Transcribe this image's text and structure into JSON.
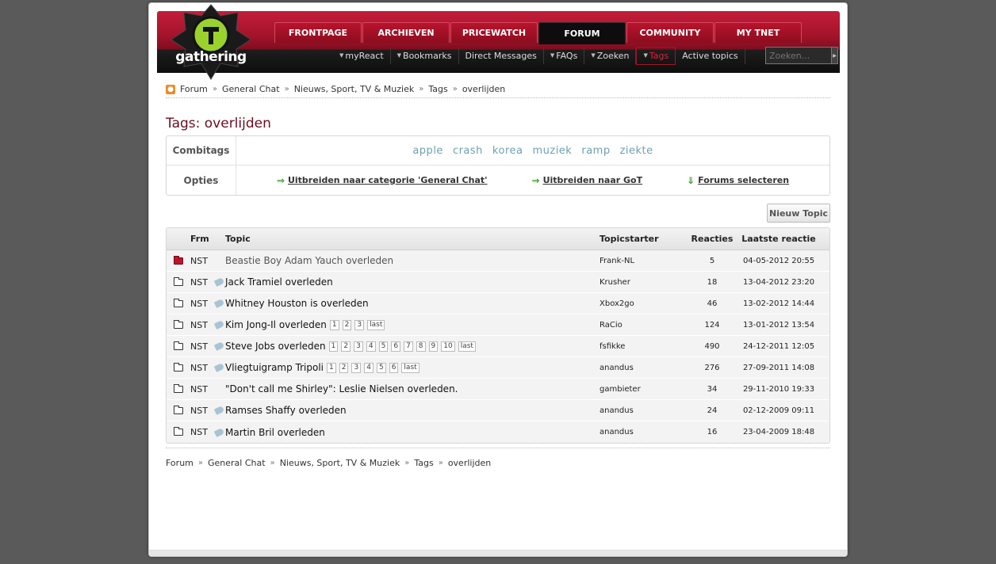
{
  "header": {
    "logo_text": "gathering",
    "top_tabs": [
      "FRONTPAGE",
      "ARCHIEVEN",
      "PRICEWATCH",
      "FORUM",
      "COMMUNITY",
      "MY TNET"
    ],
    "active_tab": "FORUM",
    "sub_nav": [
      {
        "label": "myReact",
        "caret": true
      },
      {
        "label": "Bookmarks",
        "caret": true
      },
      {
        "label": "Direct Messages",
        "caret": false
      },
      {
        "label": "FAQs",
        "caret": true
      },
      {
        "label": "Zoeken",
        "caret": true
      },
      {
        "label": "Tags",
        "caret": true
      },
      {
        "label": "Active topics",
        "caret": false
      }
    ],
    "search": {
      "placeholder": "Zoeken..."
    }
  },
  "breadcrumb": [
    "Forum",
    "General Chat",
    "Nieuws, Sport, TV & Muziek",
    "Tags",
    "overlijden"
  ],
  "page_title": "Tags: overlijden",
  "tagbox": {
    "combitags_label": "Combitags",
    "combitags": [
      "apple",
      "crash",
      "korea",
      "muziek",
      "ramp",
      "ziekte"
    ],
    "opties_label": "Opties",
    "opties": {
      "expand_category": "Uitbreiden naar categorie 'General Chat'",
      "expand_got": "Uitbreiden naar GoT",
      "select_forums": "Forums selecteren"
    }
  },
  "new_topic_label": "Nieuw Topic",
  "table": {
    "headers": {
      "frm": "Frm",
      "topic": "Topic",
      "starter": "Topicstarter",
      "reacties": "Reacties",
      "last": "Laatste reactie"
    },
    "rows": [
      {
        "frm": "NST",
        "title": "Beastie Boy Adam Yauch overleden",
        "starter": "Frank-NL",
        "reacties": "5",
        "last": "04-05-2012 20:55",
        "hot": true,
        "tag": false,
        "pages": []
      },
      {
        "frm": "NST",
        "title": "Jack Tramiel overleden",
        "starter": "Krusher",
        "reacties": "18",
        "last": "13-04-2012 23:20",
        "hot": false,
        "tag": true,
        "pages": []
      },
      {
        "frm": "NST",
        "title": "Whitney Houston is overleden",
        "starter": "Xbox2go",
        "reacties": "46",
        "last": "13-02-2012 14:44",
        "hot": false,
        "tag": true,
        "pages": []
      },
      {
        "frm": "NST",
        "title": "Kim Jong-Il overleden",
        "starter": "RaCio",
        "reacties": "124",
        "last": "13-01-2012 13:54",
        "hot": false,
        "tag": true,
        "pages": [
          "1",
          "2",
          "3",
          "last"
        ]
      },
      {
        "frm": "NST",
        "title": "Steve Jobs overleden",
        "starter": "fsfikke",
        "reacties": "490",
        "last": "24-12-2011 12:05",
        "hot": false,
        "tag": true,
        "pages": [
          "1",
          "2",
          "3",
          "4",
          "5",
          "6",
          "7",
          "8",
          "9",
          "10",
          "last"
        ]
      },
      {
        "frm": "NST",
        "title": "Vliegtuigramp Tripoli",
        "starter": "anandus",
        "reacties": "276",
        "last": "27-09-2011 14:08",
        "hot": false,
        "tag": true,
        "pages": [
          "1",
          "2",
          "3",
          "4",
          "5",
          "6",
          "last"
        ]
      },
      {
        "frm": "NST",
        "title": "\"Don't call me Shirley\": Leslie Nielsen overleden.",
        "starter": "gambieter",
        "reacties": "34",
        "last": "29-11-2010 19:33",
        "hot": false,
        "tag": false,
        "pages": []
      },
      {
        "frm": "NST",
        "title": "Ramses Shaffy overleden",
        "starter": "anandus",
        "reacties": "24",
        "last": "02-12-2009 09:11",
        "hot": false,
        "tag": true,
        "pages": []
      },
      {
        "frm": "NST",
        "title": "Martin Bril overleden",
        "starter": "anandus",
        "reacties": "16",
        "last": "23-04-2009 18:48",
        "hot": false,
        "tag": true,
        "pages": []
      }
    ]
  },
  "colors": {
    "brand_red": "#a3142a",
    "title": "#6b0d22",
    "tag_blue": "#6ea0b3",
    "arrow_green": "#3a9b2d"
  }
}
